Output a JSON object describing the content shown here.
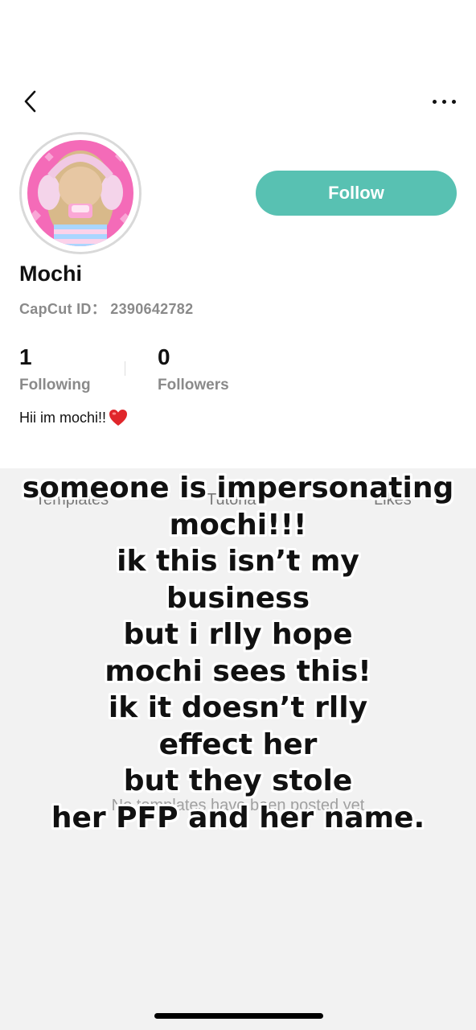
{
  "profile": {
    "name": "Mochi",
    "capcut_id": "CapCut ID： 2390642782",
    "following_count": "1",
    "following_label": "Following",
    "followers_count": "0",
    "followers_label": "Followers",
    "bio": "Hii im mochi!!"
  },
  "actions": {
    "follow_label": "Follow"
  },
  "tabs": [
    {
      "label": "Templates"
    },
    {
      "label": "Tutorial"
    },
    {
      "label": "Likes"
    }
  ],
  "empty_state": "No templates have been posted yet",
  "caption_lines": [
    "someone is impersonating",
    "mochi!!!",
    "ik this isn’t my",
    "business",
    "but i rlly hope",
    "mochi sees this!",
    "ik it doesn’t rlly",
    "effect her",
    "but they stole",
    "her PFP and her name."
  ],
  "colors": {
    "follow_button": "#58c1b2",
    "secondary_text": "#8a8a8a",
    "content_background": "#f2f2f2",
    "heart": "#e0262b"
  },
  "icons": {
    "back": "chevron-left-icon",
    "more": "more-dots-icon",
    "heart": "red-heart-icon"
  }
}
